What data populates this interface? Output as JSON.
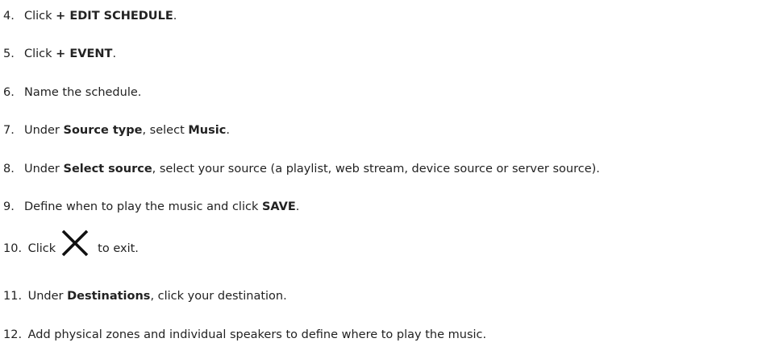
{
  "steps": [
    {
      "num": "4.",
      "text": "Click ",
      "bold": "+ EDIT SCHEDULE",
      "after": "."
    },
    {
      "num": "5.",
      "text": "Click ",
      "bold": "+ EVENT",
      "after": "."
    },
    {
      "num": "6.",
      "text": "Name the schedule."
    },
    {
      "num": "7.",
      "text": "Under ",
      "bold": "Source type",
      "after": ", select ",
      "bold2": "Music",
      "after2": "."
    },
    {
      "num": "8.",
      "text": "Under ",
      "bold": "Select source",
      "after": ", select your source (a playlist, web stream, device source or server source)."
    },
    {
      "num": "9.",
      "text": "Define when to play the music and click ",
      "bold": "SAVE",
      "after": "."
    },
    {
      "num": "10.",
      "text": "Click",
      "icon": "close-icon",
      "after": "to exit."
    },
    {
      "num": "11.",
      "text": "Under ",
      "bold": "Destinations",
      "after": ", click your destination."
    },
    {
      "num": "12.",
      "text": "Add physical zones and individual speakers to define where to play the music."
    }
  ]
}
